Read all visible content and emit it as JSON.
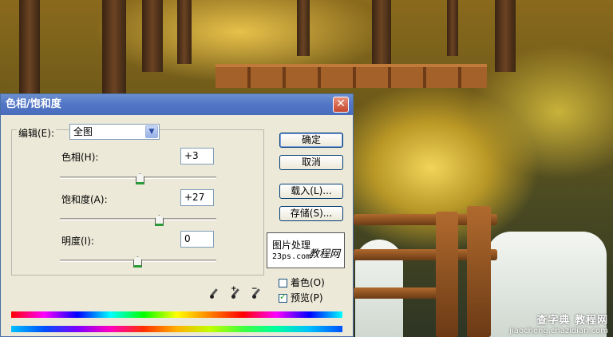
{
  "background": {
    "watermark_main": "查字典 教程网",
    "watermark_url": "jiaocheng.chazidian.com"
  },
  "dialog": {
    "title": "色相/饱和度",
    "close_glyph": "✕",
    "edit_label": "编辑(E):",
    "edit_value": "全图",
    "hue": {
      "label": "色相(H):",
      "value": "+3",
      "slider_fraction": 0.51
    },
    "saturation": {
      "label": "饱和度(A):",
      "value": "+27",
      "slider_fraction": 0.635
    },
    "lightness": {
      "label": "明度(I):",
      "value": "0",
      "slider_fraction": 0.5
    },
    "buttons": {
      "ok": "确定",
      "cancel": "取消",
      "load": "载入(L)...",
      "save": "存储(S)..."
    },
    "logo": {
      "line1": "图片处理",
      "line2": "23ps.com",
      "line3": "教程网"
    },
    "colorize": {
      "label": "着色(O)",
      "checked": false
    },
    "preview": {
      "label": "预览(P)",
      "checked": true
    },
    "icons": [
      "eyedropper-icon",
      "eyedropper-plus-icon",
      "eyedropper-minus-icon"
    ],
    "accent_color": "#4a6cbc"
  }
}
